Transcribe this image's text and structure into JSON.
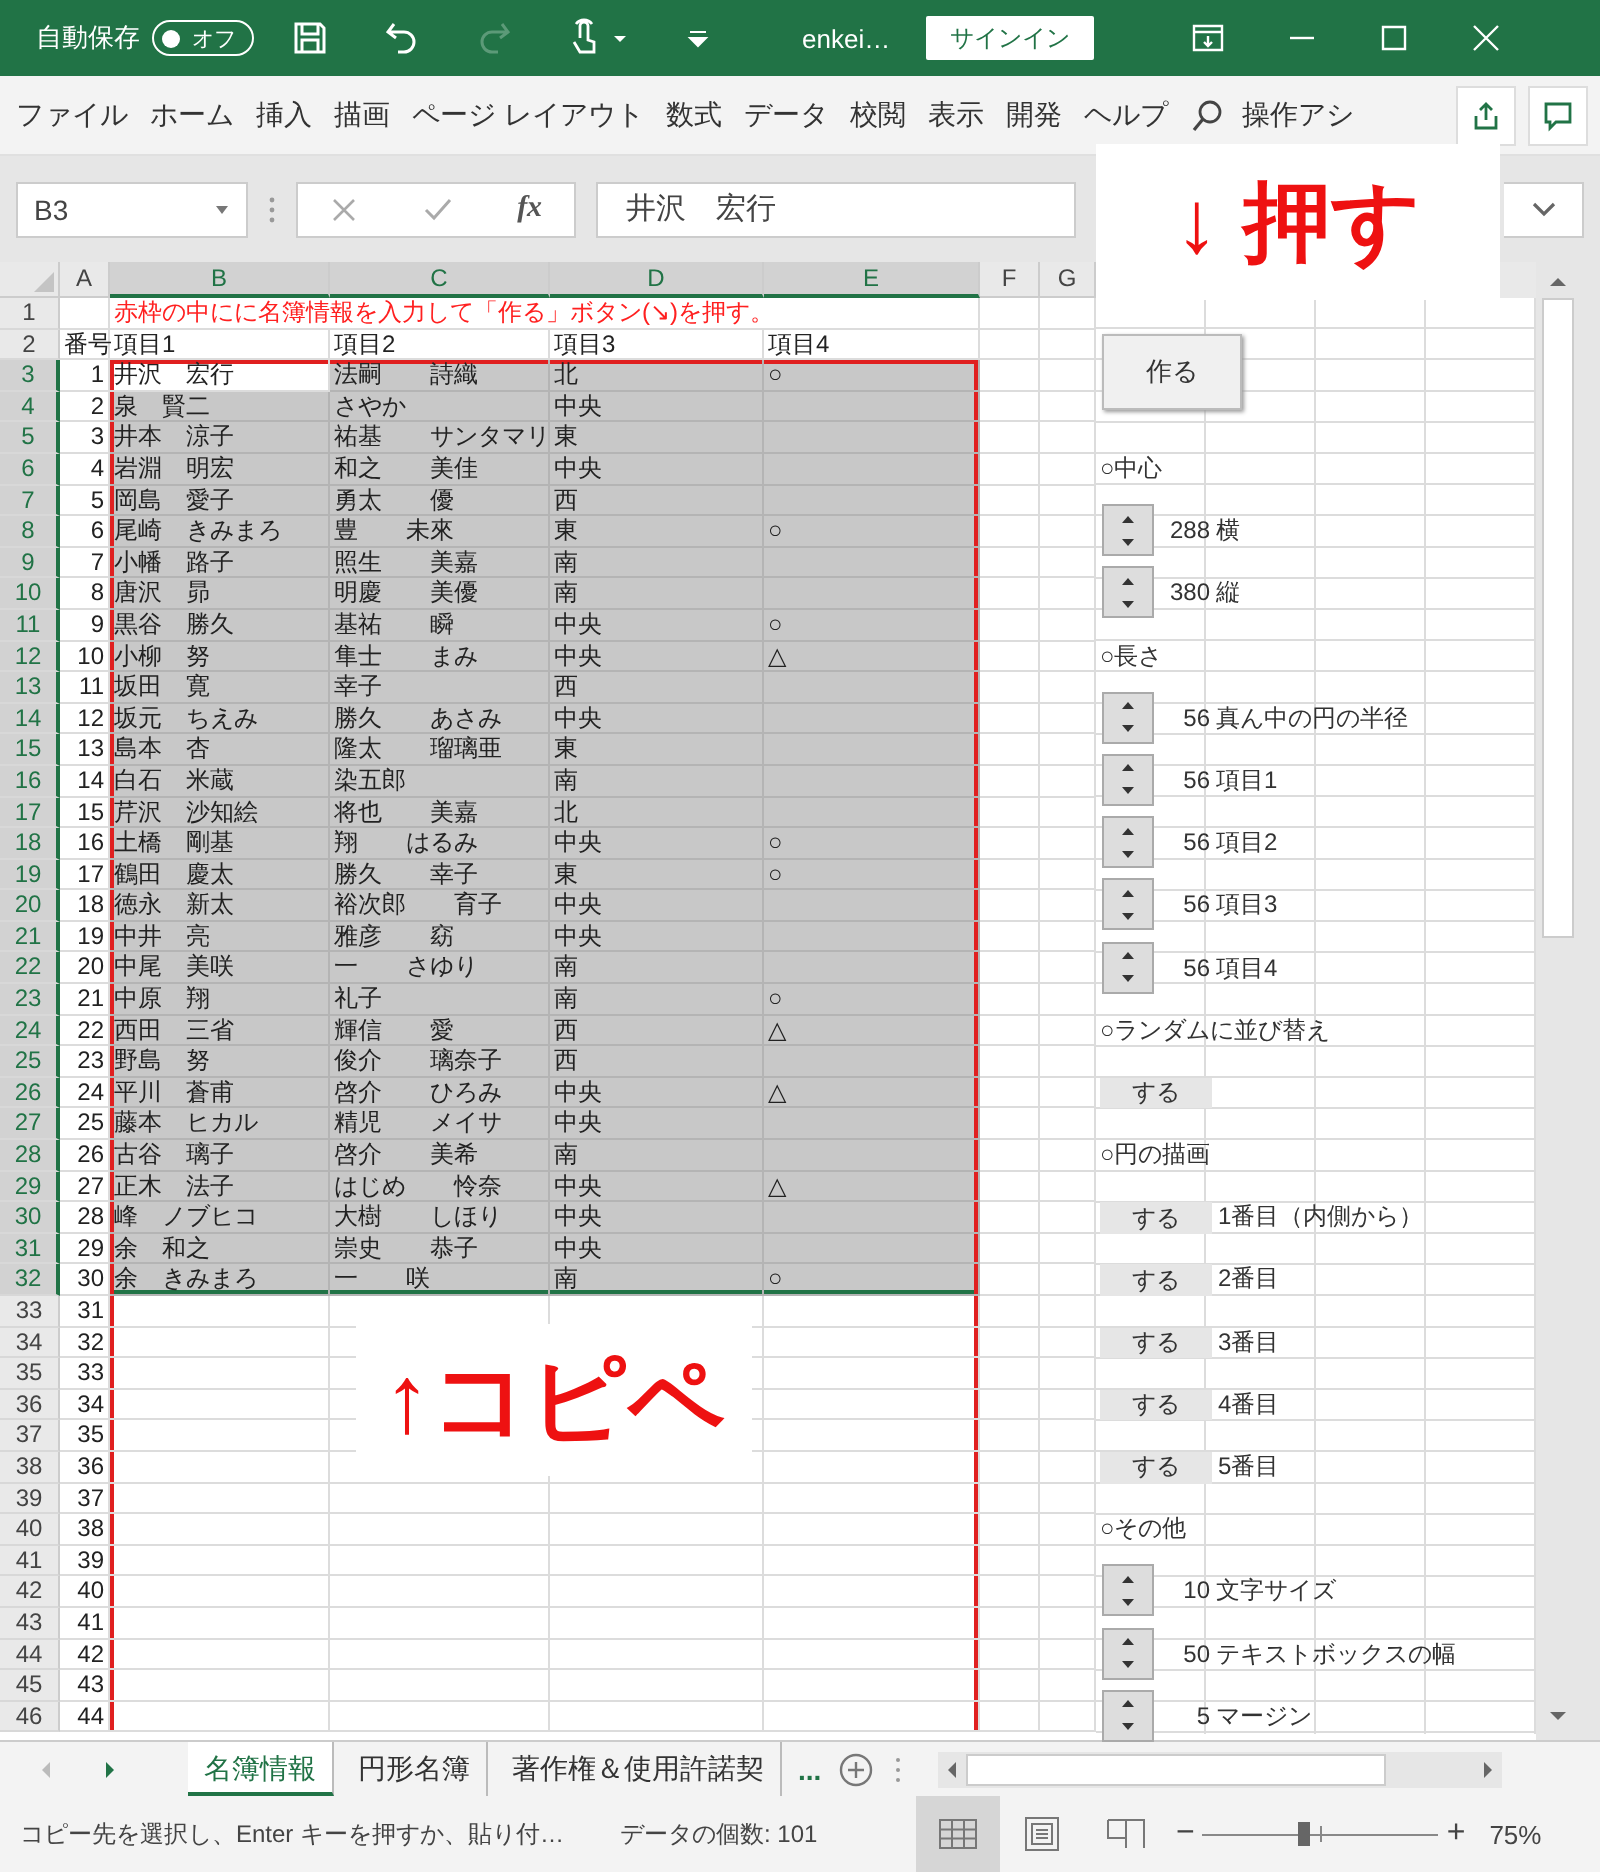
{
  "title_bar": {
    "autosave_label": "自動保存",
    "autosave_toggle": {
      "label": "オフ",
      "on": false
    },
    "redo_disabled": true,
    "file_name": "enkei…",
    "sign_in": "サインイン"
  },
  "ribbon": {
    "tabs": [
      "ファイル",
      "ホーム",
      "挿入",
      "描画",
      "ページ レイアウト",
      "数式",
      "データ",
      "校閲",
      "表示",
      "開発",
      "ヘルプ"
    ],
    "search": "操作アシ"
  },
  "formula_bar": {
    "name_box": "B3",
    "fx": "fx",
    "value": "井沢　宏行"
  },
  "columns": [
    {
      "label": "A",
      "selected": false
    },
    {
      "label": "B",
      "selected": true
    },
    {
      "label": "C",
      "selected": true
    },
    {
      "label": "D",
      "selected": true
    },
    {
      "label": "E",
      "selected": true
    },
    {
      "label": "F",
      "selected": false
    },
    {
      "label": "G",
      "selected": false
    }
  ],
  "rows": [
    {
      "num": "1",
      "kind": "note",
      "selected": false,
      "framed": false,
      "b": "赤枠の中にに名簿情報を入力して「作る」ボタン(↘)を押す。"
    },
    {
      "num": "2",
      "kind": "header",
      "selected": false,
      "framed": false,
      "a": "番号",
      "b": "項目1",
      "c": "項目2",
      "d": "項目3",
      "e": "項目4"
    },
    {
      "num": "3",
      "kind": "data",
      "selected": true,
      "framed": true,
      "a": "1",
      "b": "井沢　宏行",
      "c": "法嗣　　詩織",
      "d": "北",
      "e": "○"
    },
    {
      "num": "4",
      "kind": "data",
      "selected": true,
      "framed": true,
      "a": "2",
      "b": "泉　賢二",
      "c": "さやか",
      "d": "中央"
    },
    {
      "num": "5",
      "kind": "data",
      "selected": true,
      "framed": true,
      "a": "3",
      "b": "井本　涼子",
      "c": "祐基　　サンタマリ",
      "d": "東"
    },
    {
      "num": "6",
      "kind": "data",
      "selected": true,
      "framed": true,
      "a": "4",
      "b": "岩淵　明宏",
      "c": "和之　　美佳",
      "d": "中央"
    },
    {
      "num": "7",
      "kind": "data",
      "selected": true,
      "framed": true,
      "a": "5",
      "b": "岡島　愛子",
      "c": "勇太　　優",
      "d": "西"
    },
    {
      "num": "8",
      "kind": "data",
      "selected": true,
      "framed": true,
      "a": "6",
      "b": "尾崎　きみまろ",
      "c": "豊　　未來",
      "d": "東",
      "e": "○"
    },
    {
      "num": "9",
      "kind": "data",
      "selected": true,
      "framed": true,
      "a": "7",
      "b": "小幡　路子",
      "c": "照生　　美嘉",
      "d": "南"
    },
    {
      "num": "10",
      "kind": "data",
      "selected": true,
      "framed": true,
      "a": "8",
      "b": "唐沢　昴",
      "c": "明慶　　美優",
      "d": "南"
    },
    {
      "num": "11",
      "kind": "data",
      "selected": true,
      "framed": true,
      "a": "9",
      "b": "黒谷　勝久",
      "c": "基祐　　瞬",
      "d": "中央",
      "e": "○"
    },
    {
      "num": "12",
      "kind": "data",
      "selected": true,
      "framed": true,
      "a": "10",
      "b": "小柳　努",
      "c": "隼士　　まみ",
      "d": "中央",
      "e": "△"
    },
    {
      "num": "13",
      "kind": "data",
      "selected": true,
      "framed": true,
      "a": "11",
      "b": "坂田　寛",
      "c": "幸子",
      "d": "西"
    },
    {
      "num": "14",
      "kind": "data",
      "selected": true,
      "framed": true,
      "a": "12",
      "b": "坂元　ちえみ",
      "c": "勝久　　あさみ",
      "d": "中央"
    },
    {
      "num": "15",
      "kind": "data",
      "selected": true,
      "framed": true,
      "a": "13",
      "b": "島本　杏",
      "c": "隆太　　瑠璃亜",
      "d": "東"
    },
    {
      "num": "16",
      "kind": "data",
      "selected": true,
      "framed": true,
      "a": "14",
      "b": "白石　米蔵",
      "c": "染五郎",
      "d": "南"
    },
    {
      "num": "17",
      "kind": "data",
      "selected": true,
      "framed": true,
      "a": "15",
      "b": "芹沢　沙知絵",
      "c": "将也　　美嘉",
      "d": "北"
    },
    {
      "num": "18",
      "kind": "data",
      "selected": true,
      "framed": true,
      "a": "16",
      "b": "土橋　剛基",
      "c": "翔　　はるみ",
      "d": "中央",
      "e": "○"
    },
    {
      "num": "19",
      "kind": "data",
      "selected": true,
      "framed": true,
      "a": "17",
      "b": "鶴田　慶太",
      "c": "勝久　　幸子",
      "d": "東",
      "e": "○"
    },
    {
      "num": "20",
      "kind": "data",
      "selected": true,
      "framed": true,
      "a": "18",
      "b": "徳永　新太",
      "c": "裕次郎　　育子",
      "d": "中央"
    },
    {
      "num": "21",
      "kind": "data",
      "selected": true,
      "framed": true,
      "a": "19",
      "b": "中井　亮",
      "c": "雅彦　　窈",
      "d": "中央"
    },
    {
      "num": "22",
      "kind": "data",
      "selected": true,
      "framed": true,
      "a": "20",
      "b": "中尾　美咲",
      "c": "一　　さゆり",
      "d": "南"
    },
    {
      "num": "23",
      "kind": "data",
      "selected": true,
      "framed": true,
      "a": "21",
      "b": "中原　翔",
      "c": "礼子",
      "d": "南",
      "e": "○"
    },
    {
      "num": "24",
      "kind": "data",
      "selected": true,
      "framed": true,
      "a": "22",
      "b": "西田　三省",
      "c": "輝信　　愛",
      "d": "西",
      "e": "△"
    },
    {
      "num": "25",
      "kind": "data",
      "selected": true,
      "framed": true,
      "a": "23",
      "b": "野島　努",
      "c": "俊介　　璃奈子",
      "d": "西"
    },
    {
      "num": "26",
      "kind": "data",
      "selected": true,
      "framed": true,
      "a": "24",
      "b": "平川　蒼甫",
      "c": "啓介　　ひろみ",
      "d": "中央",
      "e": "△"
    },
    {
      "num": "27",
      "kind": "data",
      "selected": true,
      "framed": true,
      "a": "25",
      "b": "藤本　ヒカル",
      "c": "精児　　メイサ",
      "d": "中央"
    },
    {
      "num": "28",
      "kind": "data",
      "selected": true,
      "framed": true,
      "a": "26",
      "b": "古谷　璃子",
      "c": "啓介　　美希",
      "d": "南"
    },
    {
      "num": "29",
      "kind": "data",
      "selected": true,
      "framed": true,
      "a": "27",
      "b": "正木　法子",
      "c": "はじめ　　怜奈",
      "d": "中央",
      "e": "△"
    },
    {
      "num": "30",
      "kind": "data",
      "selected": true,
      "framed": true,
      "a": "28",
      "b": "峰　ノブヒコ",
      "c": "大樹　　しほり",
      "d": "中央"
    },
    {
      "num": "31",
      "kind": "data",
      "selected": true,
      "framed": true,
      "a": "29",
      "b": "余　和之",
      "c": "崇史　　恭子",
      "d": "中央"
    },
    {
      "num": "32",
      "kind": "data",
      "selected": true,
      "framed": true,
      "a": "30",
      "b": "余　きみまろ",
      "c": "一　　咲",
      "d": "南",
      "e": "○"
    },
    {
      "num": "33",
      "kind": "data",
      "selected": false,
      "framed": true,
      "a": "31"
    },
    {
      "num": "34",
      "kind": "data",
      "selected": false,
      "framed": true,
      "a": "32"
    },
    {
      "num": "35",
      "kind": "data",
      "selected": false,
      "framed": true,
      "a": "33"
    },
    {
      "num": "36",
      "kind": "data",
      "selected": false,
      "framed": true,
      "a": "34"
    },
    {
      "num": "37",
      "kind": "data",
      "selected": false,
      "framed": true,
      "a": "35"
    },
    {
      "num": "38",
      "kind": "data",
      "selected": false,
      "framed": true,
      "a": "36"
    },
    {
      "num": "39",
      "kind": "data",
      "selected": false,
      "framed": true,
      "a": "37"
    },
    {
      "num": "40",
      "kind": "data",
      "selected": false,
      "framed": true,
      "a": "38"
    },
    {
      "num": "41",
      "kind": "data",
      "selected": false,
      "framed": true,
      "a": "39"
    },
    {
      "num": "42",
      "kind": "data",
      "selected": false,
      "framed": true,
      "a": "40"
    },
    {
      "num": "43",
      "kind": "data",
      "selected": false,
      "framed": true,
      "a": "41"
    },
    {
      "num": "44",
      "kind": "data",
      "selected": false,
      "framed": true,
      "a": "42"
    },
    {
      "num": "45",
      "kind": "data",
      "selected": false,
      "framed": true,
      "a": "43"
    },
    {
      "num": "46",
      "kind": "data",
      "selected": false,
      "framed": true,
      "a": "44"
    }
  ],
  "make_button": "作る",
  "panel": [
    {
      "kind": "heading",
      "text": "○中心"
    },
    {
      "kind": "spinner",
      "value": "288",
      "label": "横"
    },
    {
      "kind": "spinner",
      "value": "380",
      "label": "縦"
    },
    {
      "kind": "heading",
      "text": "○長さ"
    },
    {
      "kind": "spinner",
      "value": "56",
      "label": "真ん中の円の半径"
    },
    {
      "kind": "spinner",
      "value": "56",
      "label": "項目1"
    },
    {
      "kind": "spinner",
      "value": "56",
      "label": "項目2"
    },
    {
      "kind": "spinner",
      "value": "56",
      "label": "項目3"
    },
    {
      "kind": "spinner",
      "value": "56",
      "label": "項目4"
    },
    {
      "kind": "heading",
      "text": "○ランダムに並び替え"
    },
    {
      "kind": "toggle",
      "button": "する"
    },
    {
      "kind": "heading",
      "text": "○円の描画"
    },
    {
      "kind": "toggle",
      "button": "する",
      "label": "1番目（内側から）"
    },
    {
      "kind": "toggle",
      "button": "する",
      "label": "2番目"
    },
    {
      "kind": "toggle",
      "button": "する",
      "label": "3番目"
    },
    {
      "kind": "toggle",
      "button": "する",
      "label": "4番目"
    },
    {
      "kind": "toggle",
      "button": "する",
      "label": "5番目"
    },
    {
      "kind": "heading",
      "text": "○その他"
    },
    {
      "kind": "spinner",
      "value": "10",
      "label": "文字サイズ"
    },
    {
      "kind": "spinner",
      "value": "50",
      "label": "テキストボックスの幅"
    },
    {
      "kind": "spinner",
      "value": "5",
      "label": "マージン"
    }
  ],
  "annotations": [
    {
      "kind": "boxed",
      "text": "↓ 押す"
    },
    {
      "kind": "plain",
      "text": "↑コピペ"
    }
  ],
  "sheet_tabs": {
    "tabs": [
      {
        "label": "名簿情報",
        "selected": true
      },
      {
        "label": "円形名簿",
        "selected": false
      },
      {
        "label": "著作権＆使用許諾契",
        "selected": false
      }
    ],
    "more": "..."
  },
  "status_bar": {
    "message": "コピー先を選択し、Enter キーを押すか、貼り付…",
    "count": "データの個数: 101",
    "views": [
      {
        "kind": "normal",
        "selected": true
      },
      {
        "kind": "page_layout",
        "selected": false
      },
      {
        "kind": "page_break",
        "selected": false
      }
    ],
    "zoom": {
      "minus": "−",
      "plus": "+",
      "level": 0.43,
      "text": "75%"
    }
  }
}
